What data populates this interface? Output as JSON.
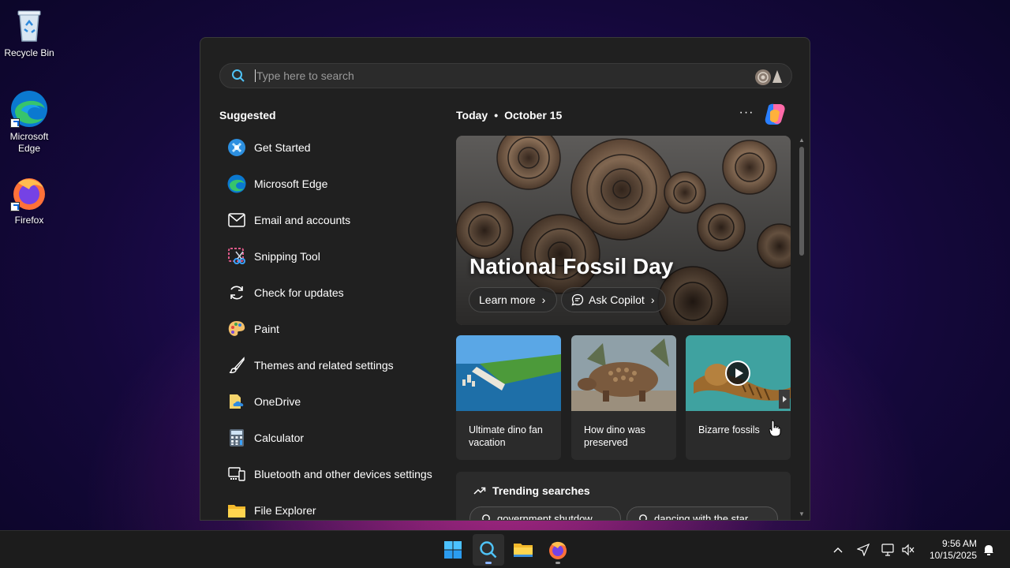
{
  "desktop": {
    "icons": [
      {
        "label": "Recycle Bin"
      },
      {
        "label": "Microsoft Edge"
      },
      {
        "label": "Firefox"
      }
    ]
  },
  "search": {
    "placeholder": "Type here to search"
  },
  "suggested": {
    "title": "Suggested",
    "items": [
      {
        "label": "Get Started",
        "icon": "get-started-icon"
      },
      {
        "label": "Microsoft Edge",
        "icon": "edge-icon"
      },
      {
        "label": "Email and accounts",
        "icon": "mail-icon"
      },
      {
        "label": "Snipping Tool",
        "icon": "snipping-tool-icon"
      },
      {
        "label": "Check for updates",
        "icon": "sync-icon"
      },
      {
        "label": "Paint",
        "icon": "paint-icon"
      },
      {
        "label": "Themes and related settings",
        "icon": "brush-icon"
      },
      {
        "label": "OneDrive",
        "icon": "onedrive-icon"
      },
      {
        "label": "Calculator",
        "icon": "calculator-icon"
      },
      {
        "label": "Bluetooth and other devices settings",
        "icon": "devices-icon"
      },
      {
        "label": "File Explorer",
        "icon": "folder-icon"
      }
    ]
  },
  "today": {
    "label": "Today",
    "date": "October 15",
    "more": "···"
  },
  "hero": {
    "title": "National Fossil Day",
    "learn_more": "Learn more",
    "ask_copilot": "Ask Copilot"
  },
  "cards": [
    {
      "caption": "Ultimate dino fan vacation"
    },
    {
      "caption": "How dino was preserved"
    },
    {
      "caption": "Bizarre fossils"
    }
  ],
  "trending": {
    "title": "Trending searches",
    "pills": [
      "government shutdow",
      "dancing with the star"
    ]
  },
  "taskbar": {
    "time": "9:56 AM",
    "date": "10/15/2025"
  },
  "colors": {
    "panel_bg": "#202020",
    "accent": "#8ab4ff"
  }
}
